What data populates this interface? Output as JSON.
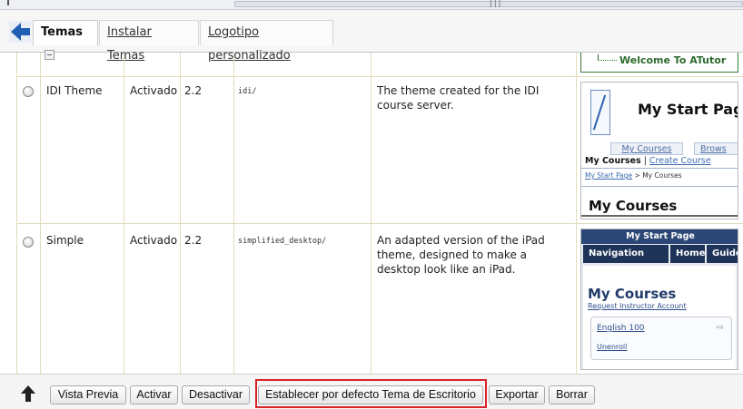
{
  "tabs": [
    {
      "label": "Temas",
      "active": true
    },
    {
      "label": "Instalar Temas",
      "active": false
    },
    {
      "label": "Logotipo personalizado",
      "active": false
    }
  ],
  "top_preview": {
    "welcome_text": "Welcome To ATutor"
  },
  "themes": [
    {
      "name": "IDI Theme",
      "status": "Activado",
      "version": "2.2",
      "directory": "idi/",
      "description": "The theme created for the IDI course server.",
      "preview": {
        "title": "My Start Page",
        "tabs": [
          "My Courses",
          "Brows"
        ],
        "nav_bold": "My Courses",
        "nav_sep": "|",
        "nav_link": "Create Course",
        "crumb_link": "My Start Page",
        "crumb_rest": "> My Courses",
        "heading": "My Courses"
      }
    },
    {
      "name": "Simple",
      "status": "Activado",
      "version": "2.2",
      "directory": "simplified_desktop/",
      "description": "An adapted version of the iPad theme, designed to make a desktop look like an iPad.",
      "preview": {
        "top": "My Start Page",
        "nav_left": "Navigation",
        "nav_home": "Home",
        "nav_guide": "Guide",
        "heading": "My Courses",
        "request": "Request Instructor Account",
        "course": "English 100",
        "unenroll": "Unenroll"
      }
    }
  ],
  "toolbar": {
    "preview": "Vista Previa",
    "activate": "Activar",
    "deactivate": "Desactivar",
    "set_default": "Establecer por defecto Tema de Escritorio",
    "export": "Exportar",
    "delete": "Borrar"
  },
  "colors": {
    "highlight": "#d8232a",
    "grid": "#e2dcb8",
    "accent": "#1f5fb3"
  }
}
